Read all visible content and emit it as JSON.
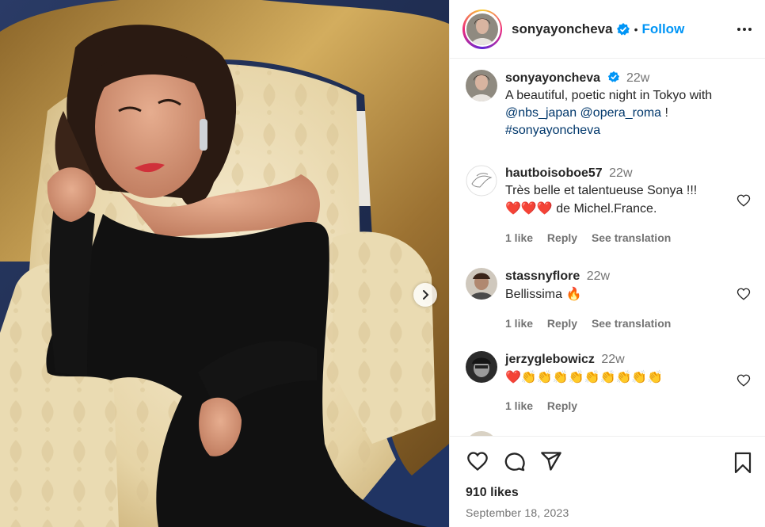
{
  "post": {
    "author": {
      "username": "sonyayoncheva",
      "verified": true,
      "follow_label": "Follow",
      "separator": "•"
    },
    "media": {
      "next_icon": "chevron-right-icon",
      "colors": {
        "wall": "#1c2a4a",
        "chair_gold": "#b8904a",
        "upholstery": "#efe2bd",
        "dress": "#111111"
      }
    },
    "caption": {
      "username": "sonyayoncheva",
      "time": "22w",
      "text": "A beautiful, poetic night in Tokyo with",
      "mention1": "@nbs_japan",
      "mention2": "@opera_roma",
      "after": "!",
      "hashtag": "#sonyayoncheva"
    },
    "comments": [
      {
        "username": "hautboisoboe57",
        "time": "22w",
        "line1": "Très belle et talentueuse Sonya !!!",
        "hearts": "❤️❤️❤️",
        "line2": "de Michel.France.",
        "likes": "1 like",
        "reply": "Reply",
        "translate": "See translation"
      },
      {
        "username": "stassnyflore",
        "time": "22w",
        "text": "Bellissima",
        "emoji": "🔥",
        "likes": "1 like",
        "reply": "Reply",
        "translate": "See translation"
      },
      {
        "username": "jerzyglebowicz",
        "time": "22w",
        "emoji": "❤️👏👏👏👏👏👏👏👏👏",
        "likes": "1 like",
        "reply": "Reply"
      }
    ],
    "actions": {
      "like_icon": "heart-icon",
      "comment_icon": "comment-icon",
      "share_icon": "share-icon",
      "save_icon": "bookmark-icon"
    },
    "likes_count": "910 likes",
    "date": "September 18, 2023",
    "accent_color": "#0095f6"
  }
}
